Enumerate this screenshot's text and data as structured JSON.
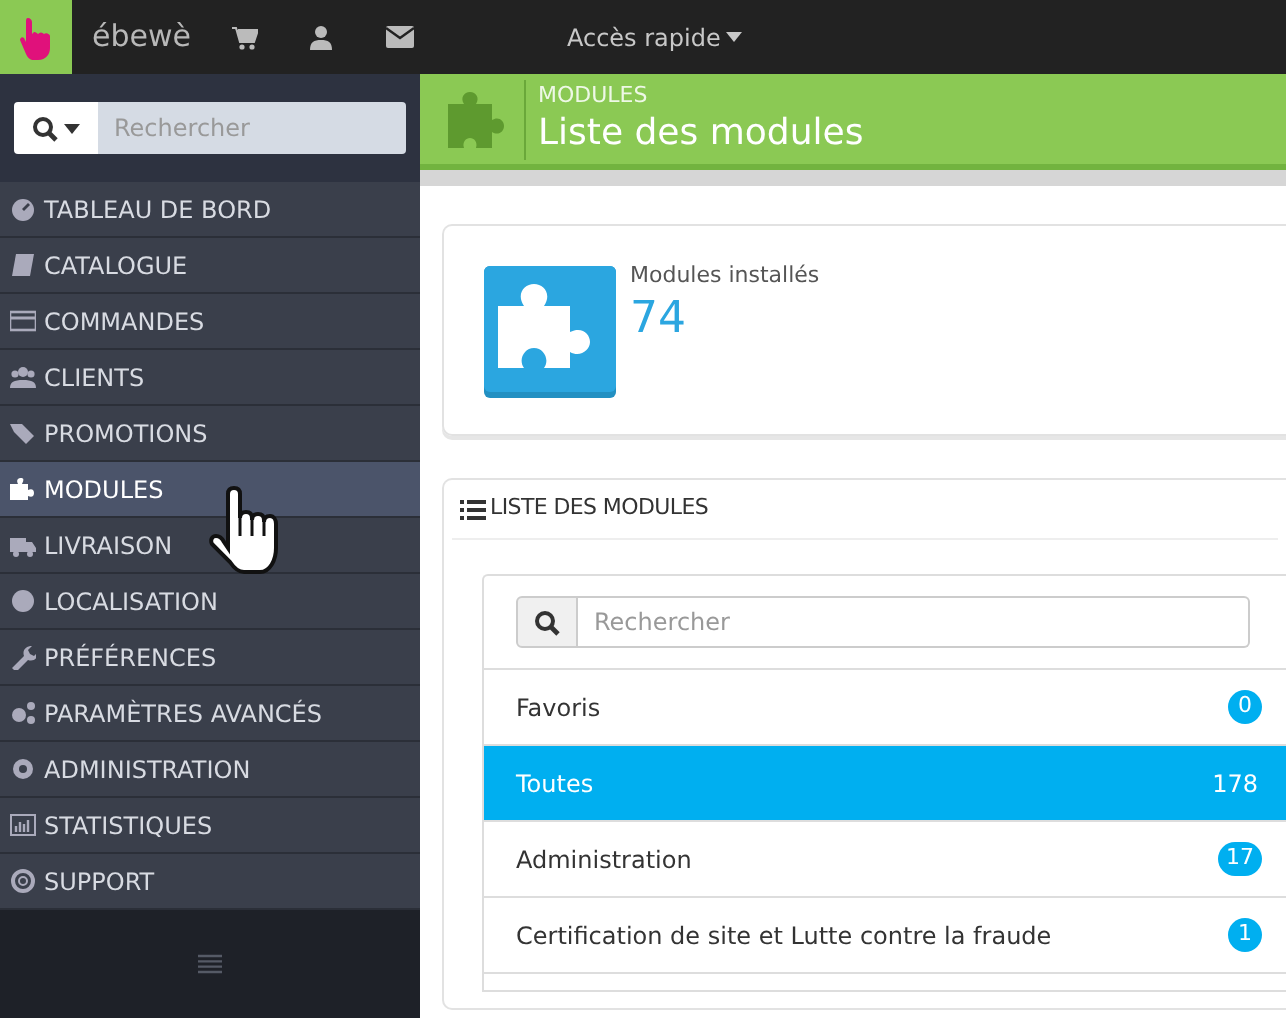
{
  "topbar": {
    "brand": "ébewè",
    "quick_access": "Accès rapide"
  },
  "sidebar": {
    "search": {
      "placeholder": "Rechercher"
    },
    "items": [
      {
        "label": "TABLEAU DE BORD",
        "selected": false
      },
      {
        "label": "CATALOGUE",
        "selected": false
      },
      {
        "label": "COMMANDES",
        "selected": false
      },
      {
        "label": "CLIENTS",
        "selected": false
      },
      {
        "label": "PROMOTIONS",
        "selected": false
      },
      {
        "label": "MODULES",
        "selected": true
      },
      {
        "label": "LIVRAISON",
        "selected": false
      },
      {
        "label": "LOCALISATION",
        "selected": false
      },
      {
        "label": "PRÉFÉRENCES",
        "selected": false
      },
      {
        "label": "PARAMÈTRES AVANCÉS",
        "selected": false
      },
      {
        "label": "ADMINISTRATION",
        "selected": false
      },
      {
        "label": "STATISTIQUES",
        "selected": false
      },
      {
        "label": "SUPPORT",
        "selected": false
      }
    ]
  },
  "page_header": {
    "breadcrumb": "MODULES",
    "title": "Liste des modules"
  },
  "stat": {
    "label": "Modules installés",
    "value": "74"
  },
  "panel": {
    "title": "LISTE DES MODULES",
    "search": {
      "placeholder": "Rechercher"
    },
    "categories": [
      {
        "label": "Favoris",
        "count": "0",
        "selected": false
      },
      {
        "label": "Toutes",
        "count": "178",
        "selected": true
      },
      {
        "label": "Administration",
        "count": "17",
        "selected": false
      },
      {
        "label": "Certification de site et Lutte contre la fraude",
        "count": "1",
        "selected": false
      }
    ]
  }
}
